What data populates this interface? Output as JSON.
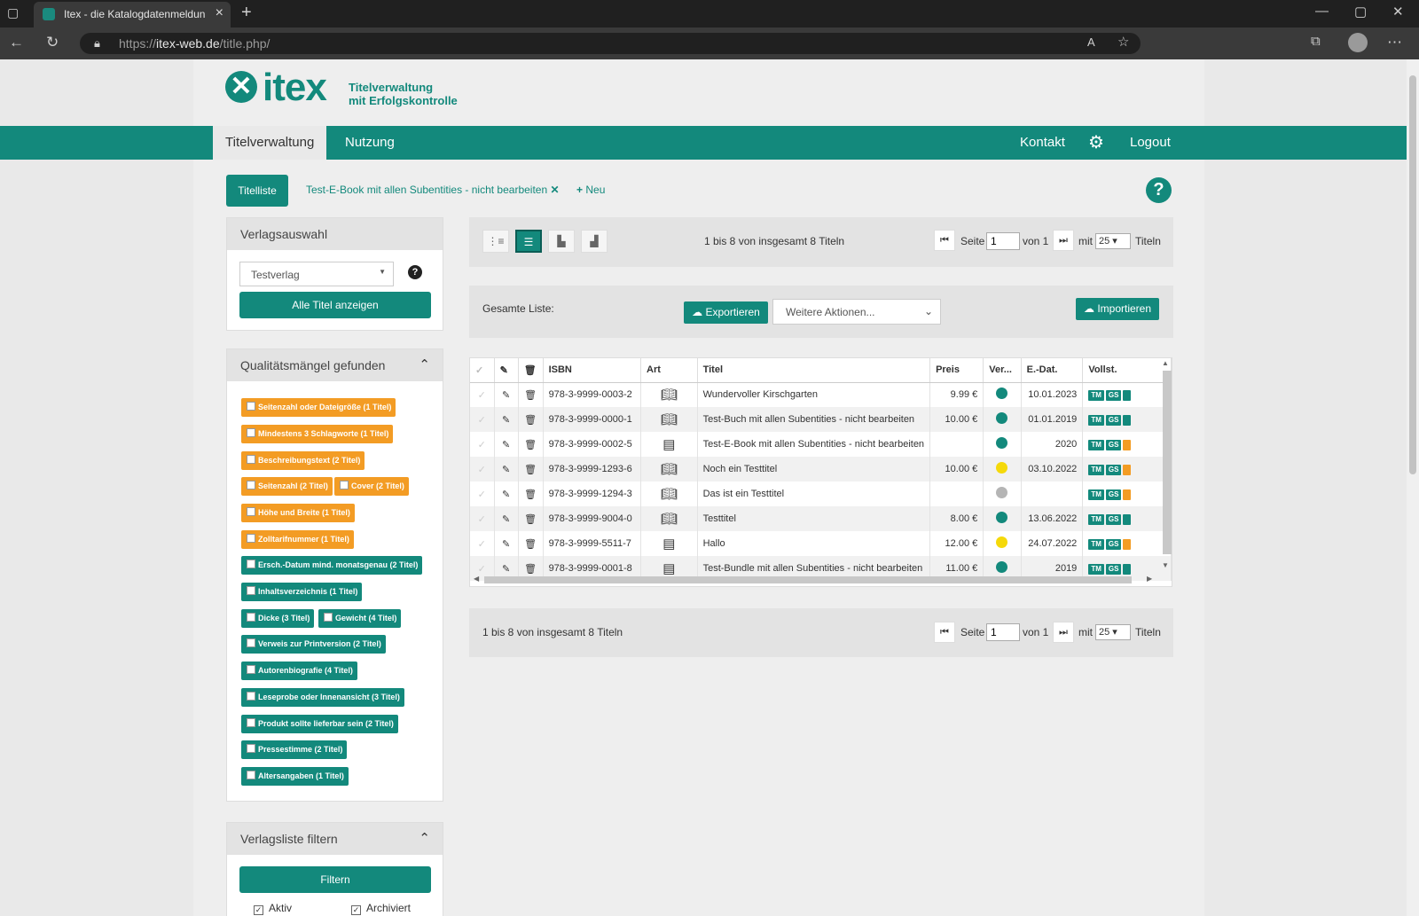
{
  "browser": {
    "tab_title": "Itex - die Katalogdatenmeldung",
    "url_prefix": "https://",
    "url_domain": "itex-web.de",
    "url_path": "/title.php/"
  },
  "brand": {
    "logo_word": "itex",
    "tagline_1": "Titelverwaltung",
    "tagline_2": "mit Erfolgskontrolle",
    "accent_color": "#13897c",
    "warn_color": "#f39c24"
  },
  "nav": {
    "tabs": [
      "Titelverwaltung",
      "Nutzung"
    ],
    "kontakt": "Kontakt",
    "logout": "Logout"
  },
  "toolbar": {
    "titelliste": "Titelliste",
    "open_tab": "Test-E-Book mit allen Subentities - nicht bearbeiten",
    "new": "Neu"
  },
  "sidebar": {
    "verlag_title": "Verlagsauswahl",
    "verlag_value": "Testverlag",
    "alle_titel": "Alle Titel anzeigen",
    "quality_title": "Qualitätsmängel gefunden",
    "quality_items": [
      {
        "label": "Seitenzahl oder Dateigröße (1 Titel)",
        "status": "warning"
      },
      {
        "label": "Mindestens 3 Schlagworte (1 Titel)",
        "status": "warning"
      },
      {
        "label": "Beschreibungstext (2 Titel)",
        "status": "warning"
      },
      {
        "label": "Seitenzahl (2 Titel)",
        "status": "warning"
      },
      {
        "label": "Cover (2 Titel)",
        "status": "warning"
      },
      {
        "label": "Höhe und Breite (1 Titel)",
        "status": "warning"
      },
      {
        "label": "Zolltarifnummer (1 Titel)",
        "status": "warning"
      },
      {
        "label": "Ersch.-Datum mind. monatsgenau (2 Titel)",
        "status": "ok"
      },
      {
        "label": "Inhaltsverzeichnis (1 Titel)",
        "status": "ok"
      },
      {
        "label": "Dicke (3 Titel)",
        "status": "ok"
      },
      {
        "label": "Gewicht (4 Titel)",
        "status": "ok"
      },
      {
        "label": "Verweis zur Printversion (2 Titel)",
        "status": "ok"
      },
      {
        "label": "Autorenbiografie (4 Titel)",
        "status": "ok"
      },
      {
        "label": "Leseprobe oder Innenansicht (3 Titel)",
        "status": "ok"
      },
      {
        "label": "Produkt sollte lieferbar sein (2 Titel)",
        "status": "ok"
      },
      {
        "label": "Pressestimme (2 Titel)",
        "status": "ok"
      },
      {
        "label": "Altersangaben (1 Titel)",
        "status": "ok"
      }
    ],
    "filter_title": "Verlagsliste filtern",
    "filter_btn": "Filtern",
    "cb_aktiv": "Aktiv",
    "cb_archiviert": "Archiviert"
  },
  "list": {
    "count_text": "1 bis 8 von insgesamt 8 Titeln",
    "seite": "Seite",
    "page": "1",
    "von": "von 1",
    "mit": "mit",
    "per_page": "25",
    "titeln": "Titeln",
    "gesamte_liste": "Gesamte Liste:",
    "exportieren": "Exportieren",
    "weitere": "Weitere Aktionen...",
    "importieren": "Importieren"
  },
  "table": {
    "headers": [
      "ISBN",
      "Art",
      "Titel",
      "Preis",
      "Ver...",
      "E.-Dat.",
      "Vollst."
    ],
    "rows": [
      {
        "isbn": "978-3-9999-0003-2",
        "art": "book",
        "titel": "Wundervoller Kirschgarten",
        "preis": "9.99 €",
        "ver": "green",
        "edat": "10.01.2023",
        "b": [
          "TM",
          "GS"
        ]
      },
      {
        "isbn": "978-3-9999-0000-1",
        "art": "book",
        "titel": "Test-Buch mit allen Subentities - nicht bearbeiten",
        "preis": "10.00 €",
        "ver": "green",
        "edat": "01.01.2019",
        "b": [
          "TM",
          "GS"
        ]
      },
      {
        "isbn": "978-3-9999-0002-5",
        "art": "ebook",
        "titel": "Test-E-Book mit allen Subentities - nicht bearbeiten",
        "preis": "",
        "ver": "green",
        "edat": "2020",
        "b": [
          "TM",
          "GS"
        ]
      },
      {
        "isbn": "978-3-9999-1293-6",
        "art": "book",
        "titel": "Noch ein Testtitel",
        "preis": "10.00 €",
        "ver": "yellow",
        "edat": "03.10.2022",
        "b": [
          "TM",
          "GS"
        ]
      },
      {
        "isbn": "978-3-9999-1294-3",
        "art": "book",
        "titel": "Das ist ein Testtitel",
        "preis": "",
        "ver": "gray",
        "edat": "",
        "b": [
          "TM",
          "GS"
        ]
      },
      {
        "isbn": "978-3-9999-9004-0",
        "art": "book",
        "titel": "Testtitel",
        "preis": "8.00 €",
        "ver": "green",
        "edat": "13.06.2022",
        "b": [
          "TM",
          "GS"
        ]
      },
      {
        "isbn": "978-3-9999-5511-7",
        "art": "ebook",
        "titel": "Hallo",
        "preis": "12.00 €",
        "ver": "yellow",
        "edat": "24.07.2022",
        "b": [
          "TM",
          "GS"
        ]
      },
      {
        "isbn": "978-3-9999-0001-8",
        "art": "ebook",
        "titel": "Test-Bundle mit allen Subentities - nicht bearbeiten",
        "preis": "11.00 €",
        "ver": "green",
        "edat": "2019",
        "b": [
          "TM",
          "GS"
        ]
      }
    ]
  }
}
